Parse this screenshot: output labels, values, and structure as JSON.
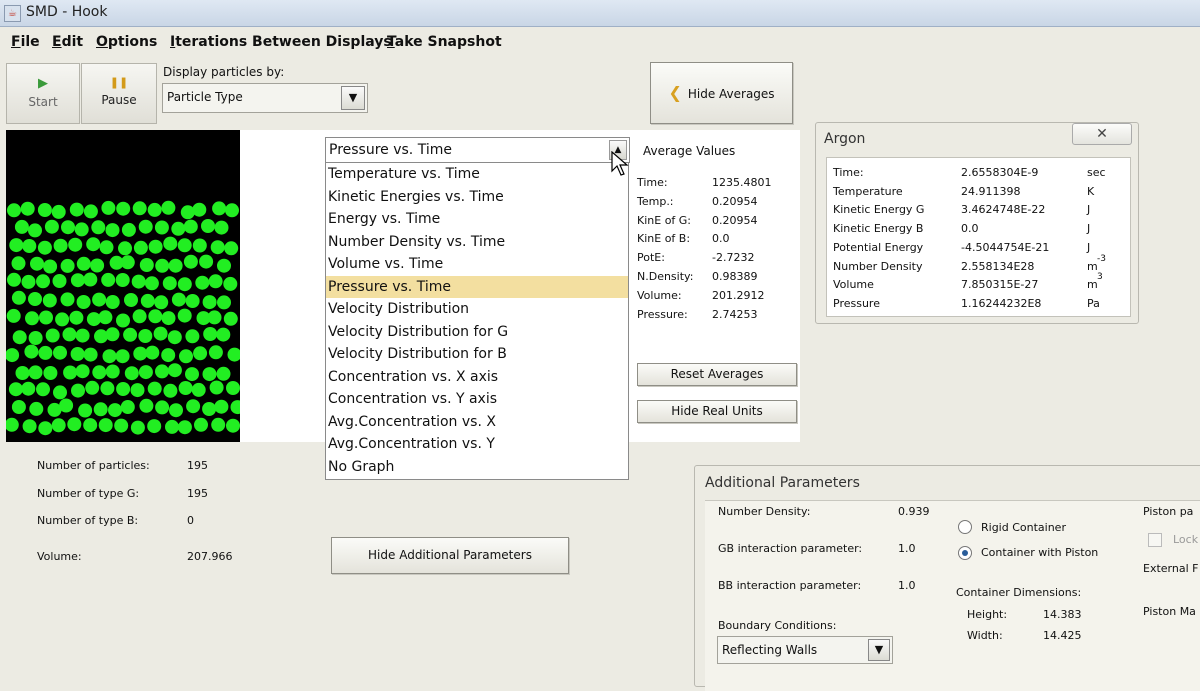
{
  "window": {
    "title": "SMD - Hook"
  },
  "menu": [
    {
      "label": "File",
      "key": "F",
      "rest": "ile"
    },
    {
      "label": "Edit",
      "key": "E",
      "rest": "dit"
    },
    {
      "label": "Options",
      "key": "O",
      "rest": "ptions"
    },
    {
      "label": "Iterations Between Displays",
      "key": "I",
      "rest": "terations Between Displays"
    },
    {
      "label": "Take Snapshot",
      "key": "T",
      "rest": "ake Snapshot"
    }
  ],
  "toolbar": {
    "start": {
      "icon": "play-icon",
      "glyph": "▶",
      "label": "Start",
      "color": "#3a9a3a"
    },
    "pause": {
      "icon": "pause-icon",
      "glyph": "❚❚",
      "label": "Pause",
      "color": "#d39a19"
    },
    "display_label": "Display particles by:",
    "display_value": "Particle Type",
    "hide_averages": "Hide Averages",
    "chevron": "❮"
  },
  "stats": [
    {
      "label": "Number of particles:",
      "value": "195"
    },
    {
      "label": "Number of type G:",
      "value": "195"
    },
    {
      "label": "Number of type B:",
      "value": "0"
    },
    {
      "label": "Volume:",
      "value": "207.966"
    }
  ],
  "graph_select": {
    "selected": "Pressure vs. Time",
    "options": [
      "Temperature vs. Time",
      "Kinetic Energies vs. Time",
      "Energy vs. Time",
      "Number Density vs. Time",
      "Volume vs. Time",
      "Pressure vs. Time",
      "Velocity Distribution",
      "Velocity Distribution for G",
      "Velocity Distribution for B",
      "Concentration vs. X axis",
      "Concentration vs. Y axis",
      "Avg.Concentration vs. X",
      "Avg.Concentration vs. Y",
      "No Graph"
    ],
    "highlighted_index": 5
  },
  "averages": {
    "title": "Average Values",
    "rows": [
      {
        "label": "Time:",
        "value": "1235.4801"
      },
      {
        "label": "Temp.:",
        "value": "0.20954"
      },
      {
        "label": "KinE of G:",
        "value": "0.20954"
      },
      {
        "label": "KinE of B:",
        "value": "0.0"
      },
      {
        "label": "PotE:",
        "value": "-2.7232"
      },
      {
        "label": "N.Density:",
        "value": "0.98389"
      },
      {
        "label": "Volume:",
        "value": "201.2912"
      },
      {
        "label": "Pressure:",
        "value": "2.74253"
      }
    ],
    "reset_button": "Reset Averages",
    "units_button": "Hide Real Units"
  },
  "hide_additional_button": "Hide Additional Parameters",
  "argon": {
    "title": "Argon",
    "close_glyph": "✕",
    "rows": [
      {
        "label": "Time:",
        "value": "2.6558304E-9",
        "unit": "sec",
        "sup": ""
      },
      {
        "label": "Temperature",
        "value": "24.911398",
        "unit": "K",
        "sup": ""
      },
      {
        "label": "Kinetic Energy G",
        "value": "3.4624748E-22",
        "unit": "J",
        "sup": ""
      },
      {
        "label": "Kinetic Energy B",
        "value": "0.0",
        "unit": "J",
        "sup": ""
      },
      {
        "label": "Potential Energy",
        "value": "-4.5044754E-21",
        "unit": "J",
        "sup": ""
      },
      {
        "label": "Number Density",
        "value": "2.558134E28",
        "unit": "m",
        "sup": "-3"
      },
      {
        "label": "Volume",
        "value": "7.850315E-27",
        "unit": "m",
        "sup": "3"
      },
      {
        "label": "Pressure",
        "value": "1.16244232E8",
        "unit": "Pa",
        "sup": ""
      }
    ]
  },
  "additional": {
    "title": "Additional Parameters",
    "number_density_label": "Number Density:",
    "number_density_value": "0.939",
    "gb_label": "GB interaction parameter:",
    "gb_value": "1.0",
    "bb_label": "BB interaction parameter:",
    "bb_value": "1.0",
    "boundary_label": "Boundary Conditions:",
    "boundary_value": "Reflecting Walls",
    "rigid_label": "Rigid Container",
    "piston_label": "Container with Piston",
    "piston_selected": true,
    "dims_label": "Container Dimensions:",
    "height_label": "Height:",
    "height_value": "14.383",
    "width_label": "Width:",
    "width_value": "14.425",
    "piston_params_label": "Piston pa",
    "lock_label": "Lock",
    "external_label": "External F",
    "piston_mass_label": "Piston Ma"
  },
  "simulation": {
    "particle_color": "#22ee22",
    "particle_count": 195
  }
}
